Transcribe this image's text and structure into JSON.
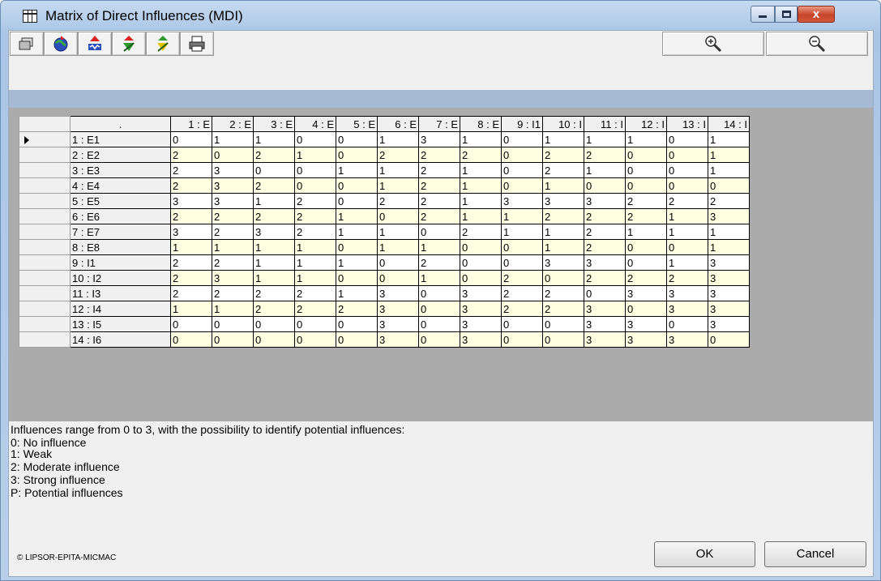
{
  "window": {
    "title": "Matrix of Direct Influences (MDI)",
    "close_glyph": "x"
  },
  "toolbar": {
    "buttons": [
      {
        "icon": "copy-icon"
      },
      {
        "icon": "globe-icon"
      },
      {
        "icon": "import-icon"
      },
      {
        "icon": "transfer-icon"
      },
      {
        "icon": "export-icon"
      },
      {
        "icon": "print-icon"
      },
      {
        "icon": "zoom-in-icon"
      },
      {
        "icon": "zoom-out-icon"
      }
    ]
  },
  "matrix": {
    "corner_label": ".",
    "column_headers": [
      "1 : E",
      "2 : E",
      "3 : E",
      "4 : E",
      "5 : E",
      "6 : E",
      "7 : E",
      "8 : E",
      "9 : I1",
      "10 : I",
      "11 : I",
      "12 : I",
      "13 : I",
      "14 : I"
    ],
    "row_labels": [
      "1 : E1",
      "2 : E2",
      "3 : E3",
      "4 : E4",
      "5 : E5",
      "6 : E6",
      "7 : E7",
      "8 : E8",
      "9 : I1",
      "10 : I2",
      "11 : I3",
      "12 : I4",
      "13 : I5",
      "14 : I6"
    ],
    "values": [
      [
        "0",
        "1",
        "1",
        "0",
        "0",
        "1",
        "3",
        "1",
        "0",
        "1",
        "1",
        "1",
        "0",
        "1"
      ],
      [
        "2",
        "0",
        "2",
        "1",
        "0",
        "2",
        "2",
        "2",
        "0",
        "2",
        "2",
        "0",
        "0",
        "1"
      ],
      [
        "2",
        "3",
        "0",
        "0",
        "1",
        "1",
        "2",
        "1",
        "0",
        "2",
        "1",
        "0",
        "0",
        "1"
      ],
      [
        "2",
        "3",
        "2",
        "0",
        "0",
        "1",
        "2",
        "1",
        "0",
        "1",
        "0",
        "0",
        "0",
        "0"
      ],
      [
        "3",
        "3",
        "1",
        "2",
        "0",
        "2",
        "2",
        "1",
        "3",
        "3",
        "3",
        "2",
        "2",
        "2"
      ],
      [
        "2",
        "2",
        "2",
        "2",
        "1",
        "0",
        "2",
        "1",
        "1",
        "2",
        "2",
        "2",
        "1",
        "3"
      ],
      [
        "3",
        "2",
        "3",
        "2",
        "1",
        "1",
        "0",
        "2",
        "1",
        "1",
        "2",
        "1",
        "1",
        "1"
      ],
      [
        "1",
        "1",
        "1",
        "1",
        "0",
        "1",
        "1",
        "0",
        "0",
        "1",
        "2",
        "0",
        "0",
        "1"
      ],
      [
        "2",
        "2",
        "1",
        "1",
        "1",
        "0",
        "2",
        "0",
        "0",
        "3",
        "3",
        "0",
        "1",
        "3"
      ],
      [
        "2",
        "3",
        "1",
        "1",
        "0",
        "0",
        "1",
        "0",
        "2",
        "0",
        "2",
        "2",
        "2",
        "3"
      ],
      [
        "2",
        "2",
        "2",
        "2",
        "1",
        "3",
        "0",
        "3",
        "2",
        "2",
        "0",
        "3",
        "3",
        "3"
      ],
      [
        "1",
        "1",
        "2",
        "2",
        "2",
        "3",
        "0",
        "3",
        "2",
        "2",
        "3",
        "0",
        "3",
        "3"
      ],
      [
        "0",
        "0",
        "0",
        "0",
        "0",
        "3",
        "0",
        "3",
        "0",
        "0",
        "3",
        "3",
        "0",
        "3"
      ],
      [
        "0",
        "0",
        "0",
        "0",
        "0",
        "3",
        "0",
        "3",
        "0",
        "0",
        "3",
        "3",
        "3",
        "0"
      ]
    ],
    "current_row_indicator": "row-1"
  },
  "legend": {
    "lines": [
      "Influences range from 0 to 3, with the possibility to identify potential influences:",
      " 0: No influence",
      "1: Weak",
      "2: Moderate influence",
      "3: Strong influence",
      "P: Potential influences"
    ]
  },
  "footer": {
    "copyright": "© LIPSOR-EPITA-MICMAC",
    "ok_label": "OK",
    "cancel_label": "Cancel"
  }
}
